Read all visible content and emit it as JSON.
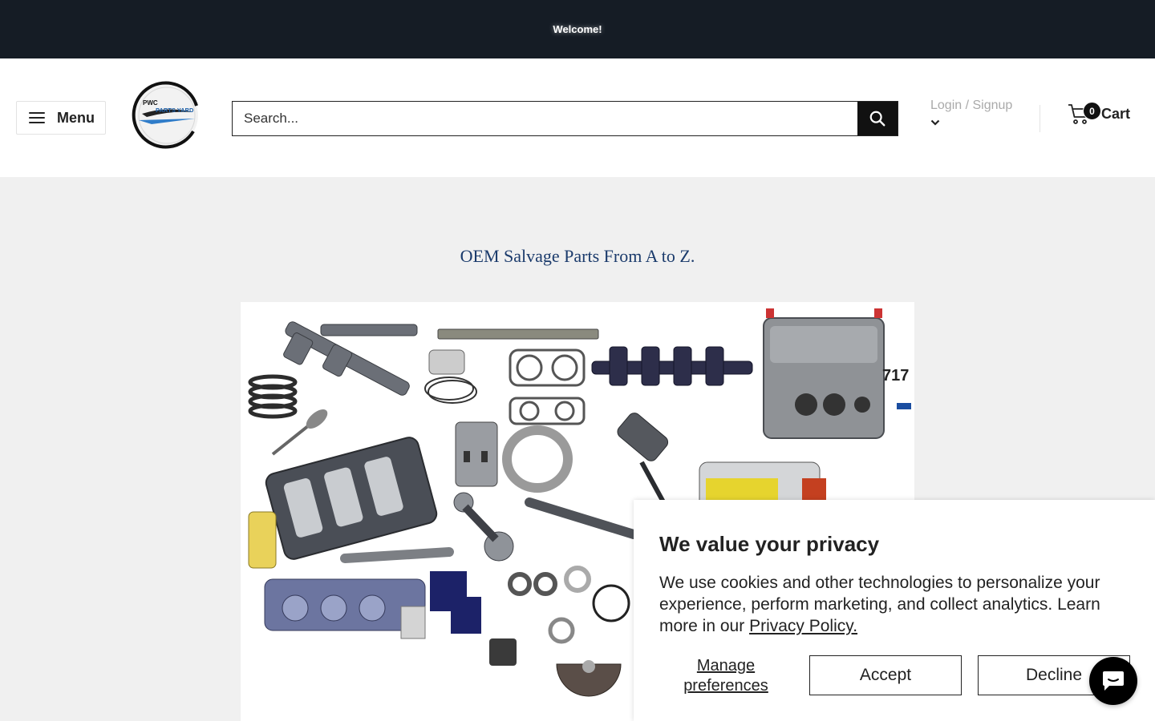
{
  "announcement": {
    "text": "Welcome!"
  },
  "header": {
    "menu_label": "Menu",
    "logo": {
      "line1": "PWC",
      "line2": "PARTS YARD"
    },
    "search": {
      "placeholder": "Search...",
      "value": ""
    },
    "login_label": "Login / Signup",
    "cart": {
      "count": "0",
      "label": "Cart"
    }
  },
  "main": {
    "tagline": "OEM Salvage Parts From A to Z.",
    "hero": {
      "engine_label": "717"
    }
  },
  "consent": {
    "title": "We value your privacy",
    "body": "We use cookies and other technologies to personalize your experience, perform marketing, and collect analytics. Learn more in our",
    "policy_link": "Privacy Policy.",
    "manage_label": "Manage preferences",
    "accept_label": "Accept",
    "decline_label": "Decline"
  },
  "colors": {
    "announcement_bg": "#151c25",
    "tagline": "#1b3b6c",
    "button_dark": "#111111"
  }
}
